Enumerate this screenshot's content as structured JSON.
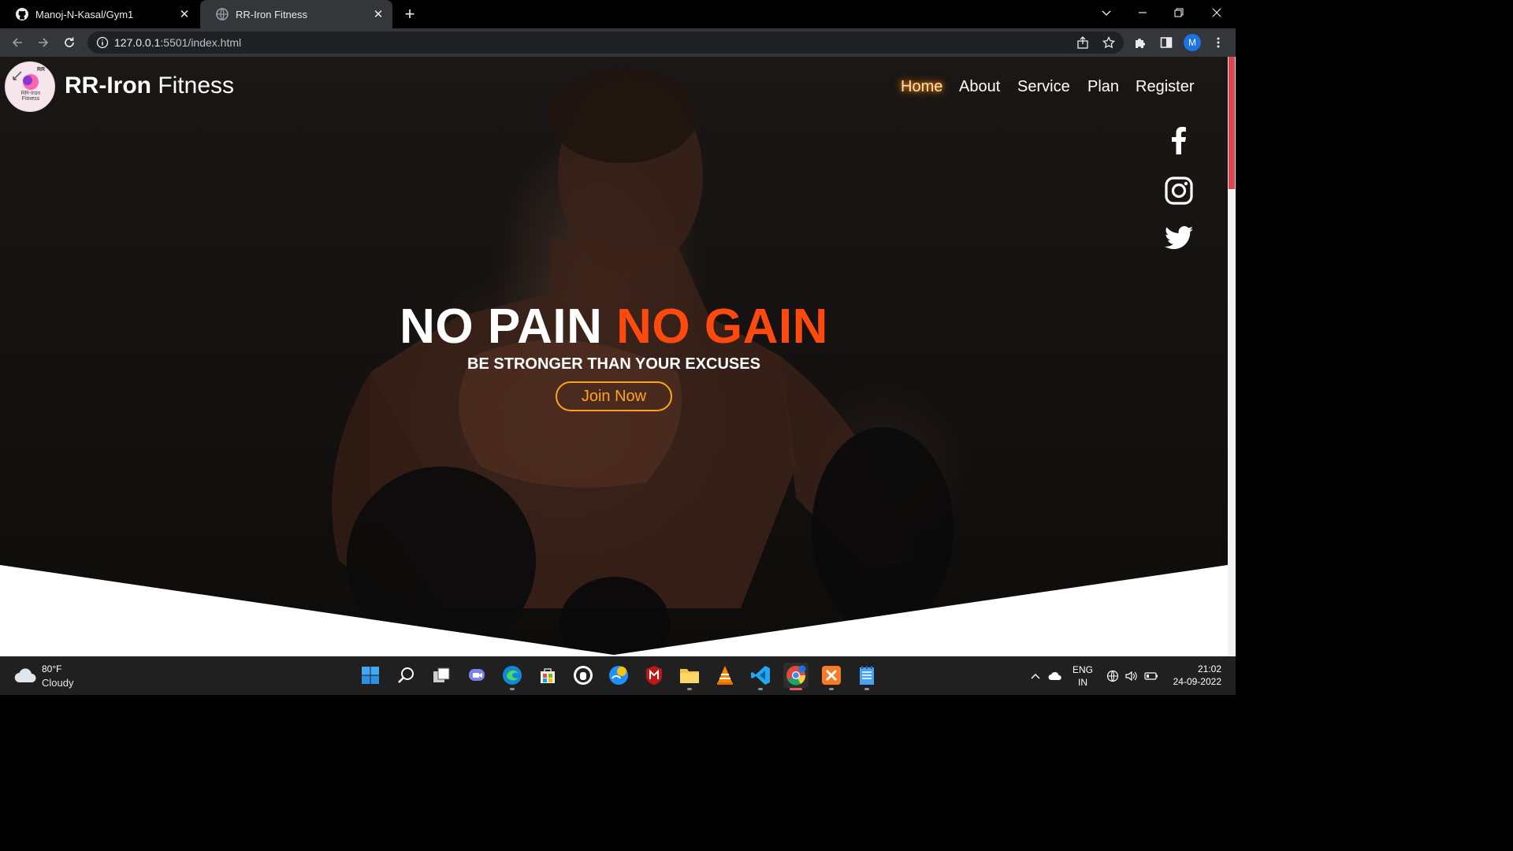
{
  "browser": {
    "tabs": [
      {
        "title": "Manoj-N-Kasal/Gym1",
        "icon": "github-icon"
      },
      {
        "title": "RR-Iron Fitness",
        "icon": "globe-icon"
      }
    ],
    "url_host": "127.0.0.1",
    "url_rest": ":5501/index.html",
    "profile_initial": "M"
  },
  "site": {
    "logo_text": "RR-Iron Fitness",
    "logo_mark": "RR",
    "brand_bold": "RR-Iron",
    "brand_rest": " Fitness",
    "nav": [
      "Home",
      "About",
      "Service",
      "Plan",
      "Register"
    ],
    "social": [
      "facebook-icon",
      "instagram-icon",
      "twitter-icon"
    ],
    "headline_white": "NO PAIN",
    "headline_accent": "NO GAIN",
    "subline": "BE STRONGER THAN YOUR EXCUSES",
    "cta": "Join Now",
    "colors": {
      "accent": "#ff4a0f",
      "cta": "#ffa41a",
      "nav_glow": "#ff8a00"
    }
  },
  "taskbar": {
    "temperature": "80°F",
    "condition": "Cloudy",
    "language_1": "ENG",
    "language_2": "IN",
    "time": "21:02",
    "date": "24-09-2022"
  }
}
